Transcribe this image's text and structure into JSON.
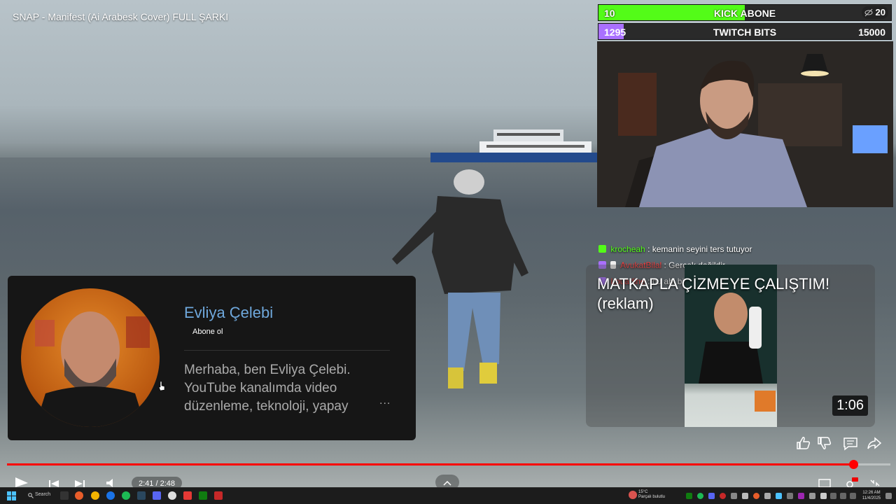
{
  "video": {
    "title": "SNAP - Manifest (Ai Arabesk Cover) FULL ŞARKI",
    "current_time": "2:41",
    "duration": "2:48",
    "time_display": "2:41 / 2:48",
    "progress": 0.958
  },
  "goals": {
    "kick": {
      "current": "10",
      "label": "KICK ABONE",
      "target": "20",
      "progress": 0.5
    },
    "twitch": {
      "current": "1295",
      "label": "TWITCH BITS",
      "target": "15000",
      "progress": 0.086
    }
  },
  "chat": [
    {
      "user": "krocheah",
      "text": ": kemanin seyini ters tutuyor"
    },
    {
      "user": "AvukatBilal",
      "text": ": Gerçek değildir"
    },
    {
      "user": "Louadine",
      "text": ": bu abi bir m"
    }
  ],
  "endcard_video": {
    "title": "MATKAPLA ÇİZMEYE ÇALIŞTIM! (reklam)",
    "duration": "1:06"
  },
  "channel_card": {
    "name": "Evliya Çelebi",
    "subscribe": "Abone ol",
    "description": "Merhaba, ben Evliya Çelebi. YouTube kanalımda video düzenleme, teknoloji, yapay",
    "more": "..."
  },
  "taskbar": {
    "search": "Search",
    "weather_temp": "15°C",
    "weather_desc": "Parçalı bulutlu",
    "time": "12:26 AM",
    "date": "11/4/2025"
  },
  "colors": {
    "kick": "#53fc18",
    "twitch": "#a970ff",
    "progress": "#ff0000",
    "channel_name": "#6fa8dc"
  }
}
